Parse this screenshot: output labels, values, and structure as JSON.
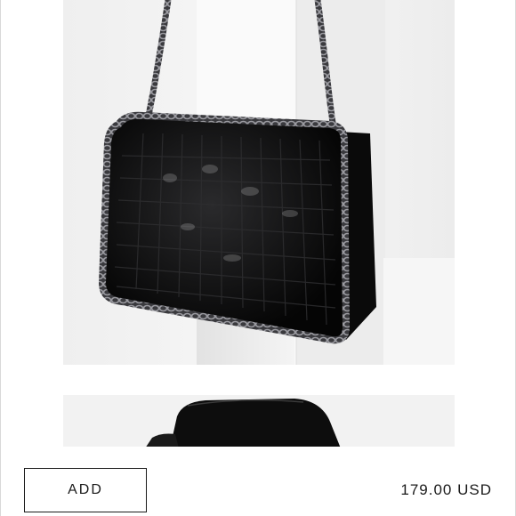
{
  "product": {
    "images": [
      {
        "description": "black-quilted-crossbody-bag-with-chain-front",
        "icon": "product-photo"
      },
      {
        "description": "black-bag-second-view",
        "icon": "product-photo"
      }
    ],
    "add_label": "ADD",
    "price": "179.00 USD"
  },
  "colors": {
    "background": "#ffffff",
    "photo_background": "#f2f2f2",
    "text": "#1a1a1a",
    "bag": "#0d0d0d",
    "chain": "#6b6b70"
  }
}
